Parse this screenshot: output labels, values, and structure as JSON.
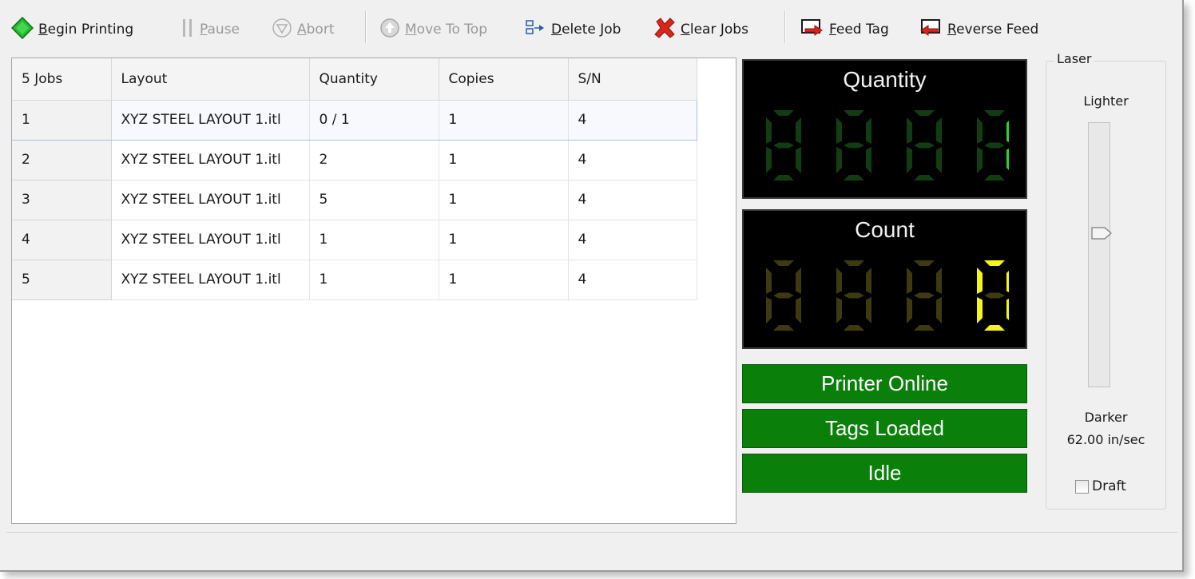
{
  "toolbar": {
    "begin_printing": "Begin Printing",
    "pause": "Pause",
    "abort": "Abort",
    "move_to_top": "Move To Top",
    "delete_job": "Delete Job",
    "clear_jobs": "Clear Jobs",
    "feed_tag": "Feed Tag",
    "reverse_feed": "Reverse Feed",
    "disabled": [
      "pause",
      "abort",
      "move_to_top"
    ]
  },
  "jobs_table": {
    "headers": [
      "5 Jobs",
      "Layout",
      "Quantity",
      "Copies",
      "S/N"
    ],
    "selected_row": 0,
    "rows": [
      [
        "1",
        "XYZ STEEL LAYOUT 1.itl",
        "0 / 1",
        "1",
        "4"
      ],
      [
        "2",
        "XYZ STEEL LAYOUT 1.itl",
        "2",
        "1",
        "4"
      ],
      [
        "3",
        "XYZ STEEL LAYOUT 1.itl",
        "5",
        "1",
        "4"
      ],
      [
        "4",
        "XYZ STEEL LAYOUT 1.itl",
        "1",
        "1",
        "4"
      ],
      [
        "5",
        "XYZ STEEL LAYOUT 1.itl",
        "1",
        "1",
        "4"
      ]
    ]
  },
  "quantity_display": {
    "title": "Quantity",
    "value": 1,
    "digit_count": 4,
    "on_color": "#2ad42a",
    "off_color": "#123d12"
  },
  "count_display": {
    "title": "Count",
    "value": 0,
    "digit_count": 4,
    "on_color": "#f5f51a",
    "off_color": "#3d3a10"
  },
  "status_indicators": [
    "Printer Online",
    "Tags Loaded",
    "Idle"
  ],
  "status_color": "#0a800a",
  "laser": {
    "group_label": "Laser",
    "lighter_label": "Lighter",
    "darker_label": "Darker",
    "speed": "62.00 in/sec",
    "draft_label": "Draft",
    "draft_checked": false
  },
  "icons": {
    "begin_printing": "green-diamond-icon",
    "pause": "pause-bars-icon",
    "abort": "abort-triangle-icon",
    "move_to_top": "up-arrow-circle-icon",
    "delete_job": "delete-job-icon",
    "clear_jobs": "red-x-icon",
    "feed_tag": "feed-arrow-right-icon",
    "reverse_feed": "feed-arrow-left-icon"
  }
}
